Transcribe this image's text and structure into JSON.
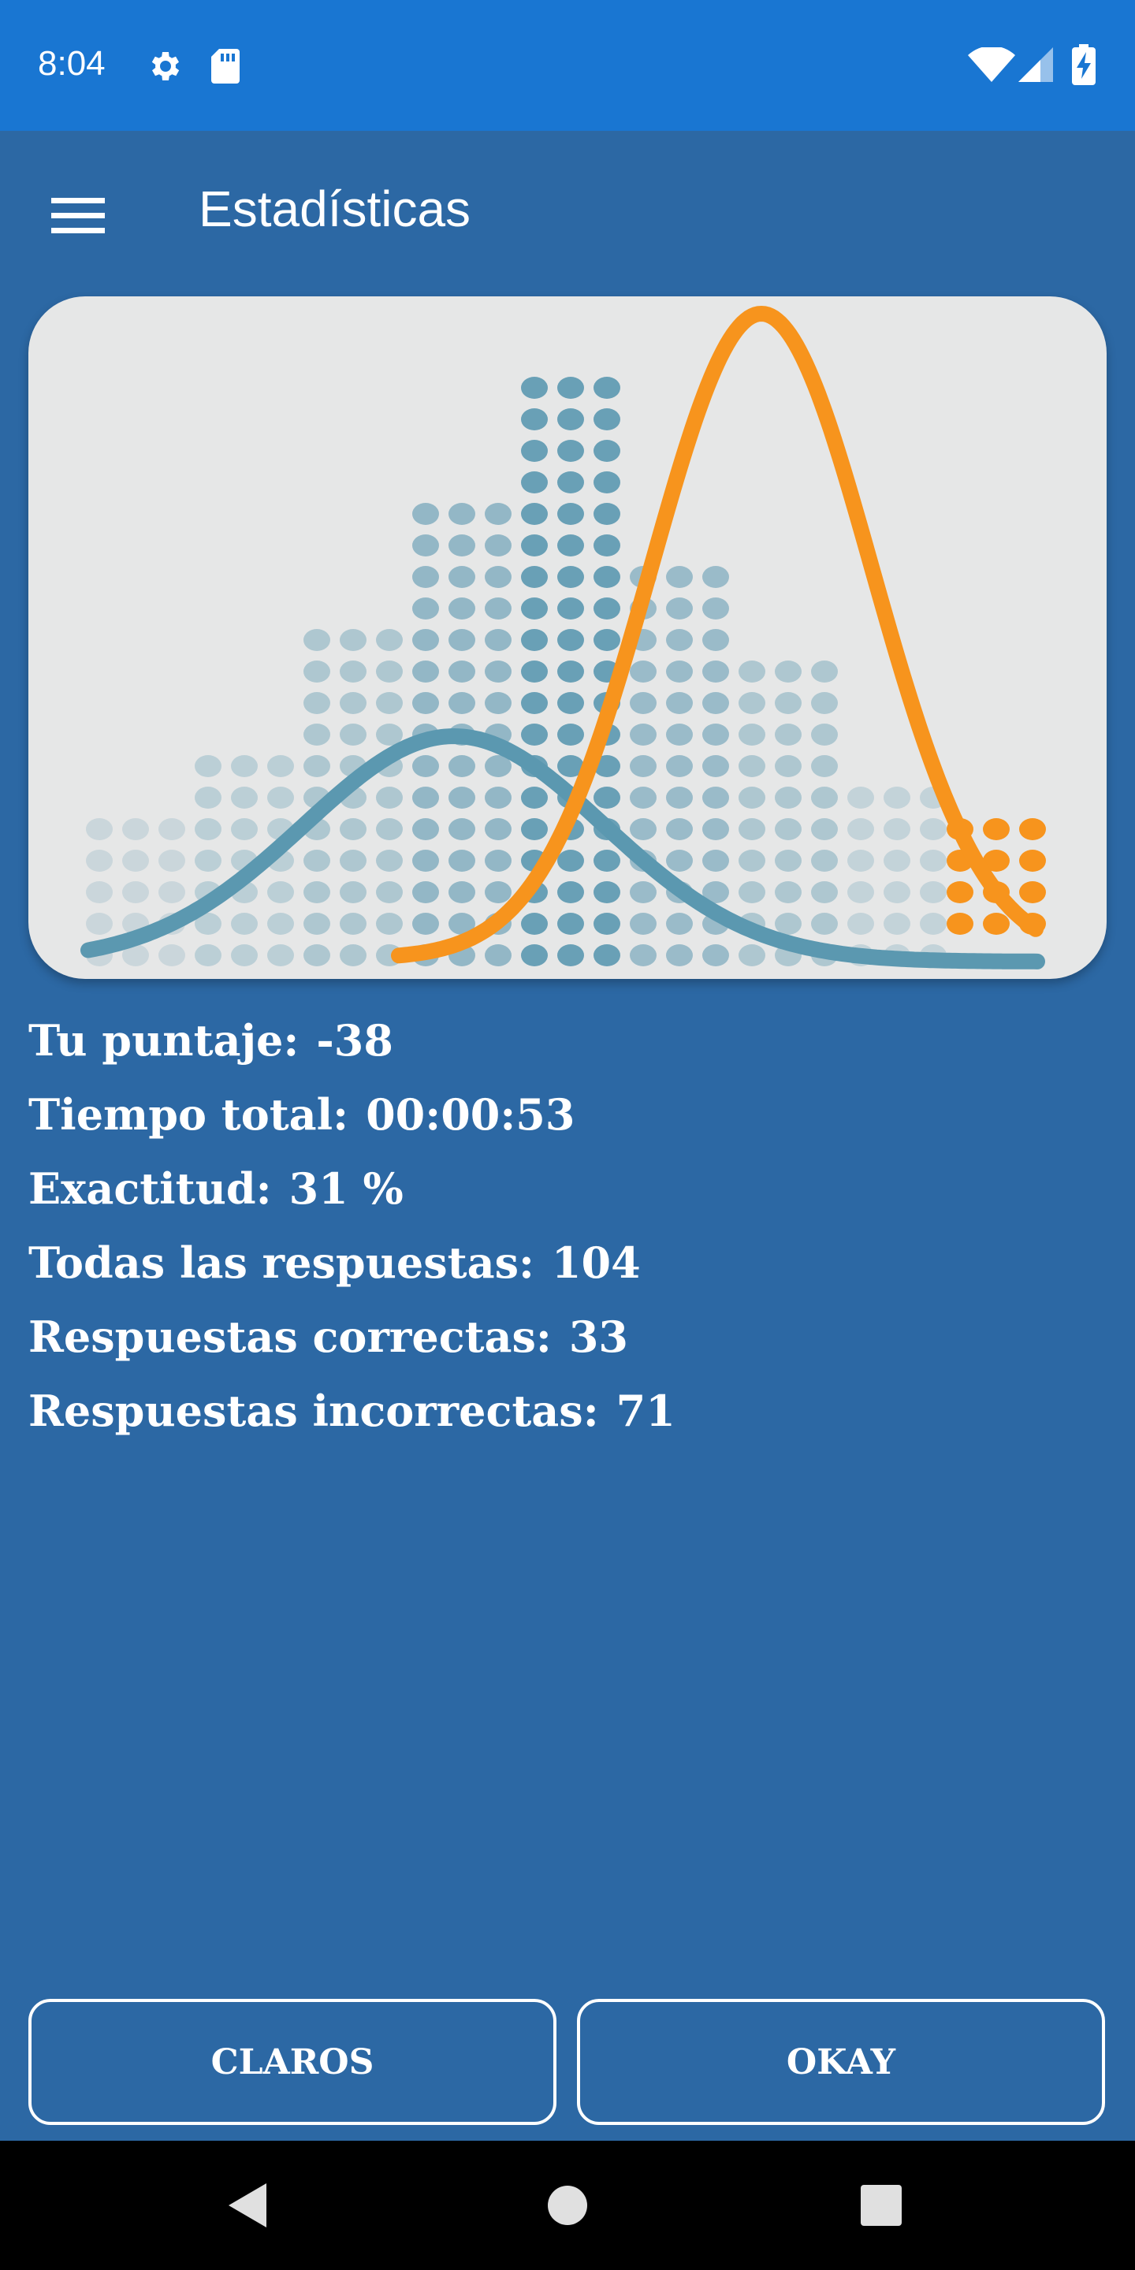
{
  "status_bar": {
    "time": "8:04",
    "icons": [
      "gear-icon",
      "sd-card-icon",
      "wifi-icon",
      "signal-icon",
      "battery-charging-icon"
    ]
  },
  "app_bar": {
    "menu_icon": "hamburger-menu-icon",
    "title": "Estadísticas"
  },
  "illustration": {
    "dot_color": "#5b98b0",
    "bell_curve_colors": {
      "wide": "#5b98b0",
      "narrow": "#f7941d"
    }
  },
  "stats": [
    {
      "label": "Tu puntaje:",
      "value": "-38"
    },
    {
      "label": "Tiempo total:",
      "value": "00:00:53"
    },
    {
      "label": "Exactitud:",
      "value": "31 %"
    },
    {
      "label": "Todas las respuestas:",
      "value": "104"
    },
    {
      "label": "Respuestas correctas:",
      "value": "33"
    },
    {
      "label": "Respuestas incorrectas:",
      "value": "71"
    }
  ],
  "buttons": {
    "clear": "CLAROS",
    "ok": "OKAY"
  },
  "nav_bar": {
    "icons": [
      "back-icon",
      "home-icon",
      "recents-icon"
    ]
  },
  "colors": {
    "status_bar": "#1976d2",
    "background": "#2c68a4",
    "card": "#e6e7e7",
    "accent_orange": "#f7941d"
  }
}
